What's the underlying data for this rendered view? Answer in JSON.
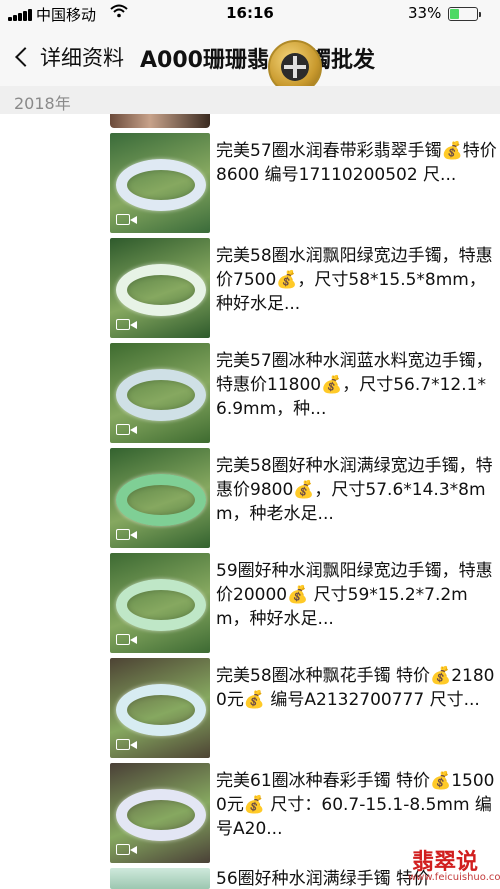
{
  "status": {
    "carrier": "中国移动",
    "time": "16:16",
    "battery": "33%",
    "battery_level": 0.33
  },
  "nav": {
    "back_label": "详细资料",
    "title": "A000珊珊翡",
    "title_tail": "镯批发"
  },
  "year": "2018年",
  "posts": [
    {
      "text": "完美57圈水润春带彩翡翠手镯💰特价8600 编号17110200502 尺...",
      "band": "#dfe9f3",
      "bg": "#3a6b3a"
    },
    {
      "text": "完美58圈水润飘阳绿宽边手镯，特惠价7500💰，尺寸58*15.5*8mm，种好水足...",
      "band": "#e7f3e6",
      "bg": "#2e5a2c"
    },
    {
      "text": "完美57圈冰种水润蓝水料宽边手镯，特惠价11800💰，尺寸56.7*12.1*6.9mm，种...",
      "band": "#cfe0e6",
      "bg": "#3e6b30"
    },
    {
      "text": "完美58圈好种水润满绿宽边手镯，特惠价9800💰，尺寸57.6*14.3*8mm，种老水足...",
      "band": "#7fcf95",
      "bg": "#33622f"
    },
    {
      "text": "59圈好种水润飘阳绿宽边手镯，特惠价20000💰 尺寸59*15.2*7.2mm，种好水足...",
      "band": "#bfe7c7",
      "bg": "#3d6a33"
    },
    {
      "text": "完美58圈冰种飘花手镯 特价💰21800元💰 编号A2132700777 尺寸...",
      "band": "#d7ecf2",
      "bg": "#4d4334"
    },
    {
      "text": "完美61圈冰种春彩手镯 特价💰15000元💰 尺寸：60.7-15.1-8.5mm 编号A20...",
      "band": "#e3e6f4",
      "bg": "#4a4037"
    }
  ],
  "next_post_partial": "56圈好种水润满绿手镯 特价",
  "watermark": {
    "brand": "翡翠说",
    "domain": "www.feicuishuo.com"
  }
}
